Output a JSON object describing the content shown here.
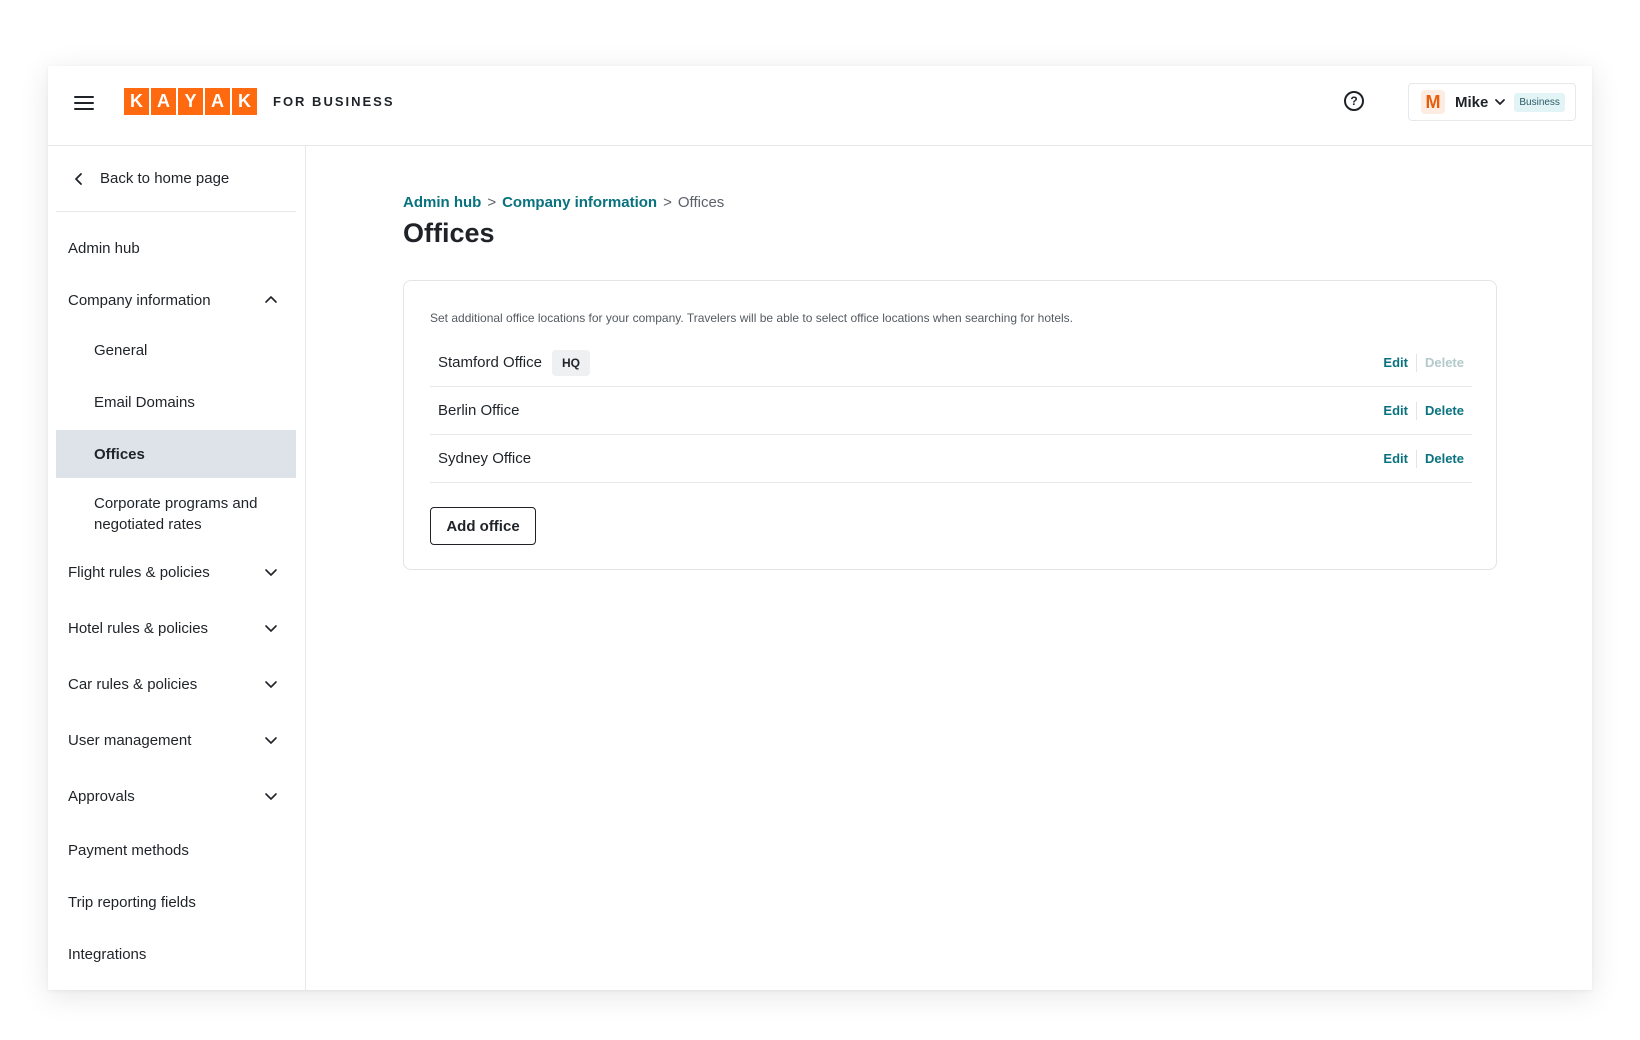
{
  "header": {
    "brand_letters": [
      "K",
      "A",
      "Y",
      "A",
      "K"
    ],
    "brand_suffix": "FOR BUSINESS",
    "user": {
      "avatar_initial": "M",
      "name": "Mike",
      "badge": "Business"
    },
    "brand_color": "#ff690f",
    "icons": [
      "hamburger-menu-icon",
      "help-icon",
      "chevron-down-icon"
    ]
  },
  "sidebar": {
    "back_label": "Back to home page",
    "items": [
      {
        "label": "Admin hub"
      },
      {
        "label": "Company information",
        "expanded": true
      },
      {
        "label": "General"
      },
      {
        "label": "Email Domains"
      },
      {
        "label": "Offices",
        "active": true
      },
      {
        "label": "Corporate programs and negotiated rates"
      },
      {
        "label": "Flight rules & policies"
      },
      {
        "label": "Hotel rules & policies"
      },
      {
        "label": "Car rules & policies"
      },
      {
        "label": "User management"
      },
      {
        "label": "Approvals"
      },
      {
        "label": "Payment methods"
      },
      {
        "label": "Trip reporting fields"
      },
      {
        "label": "Integrations"
      }
    ]
  },
  "breadcrumb": {
    "items": [
      "Admin hub",
      "Company information",
      "Offices"
    ],
    "separator": ">"
  },
  "page": {
    "title": "Offices"
  },
  "offices": {
    "description": "Set additional office locations for your company. Travelers will be able to select office locations when searching for hotels.",
    "rows": [
      {
        "name": "Stamford Office",
        "badge": "HQ",
        "edit": "Edit",
        "delete": "Delete",
        "delete_disabled": true
      },
      {
        "name": "Berlin Office",
        "edit": "Edit",
        "delete": "Delete"
      },
      {
        "name": "Sydney Office",
        "edit": "Edit",
        "delete": "Delete"
      }
    ],
    "add_label": "Add office"
  },
  "colors": {
    "link": "#08727f",
    "active_nav_bg": "#dde3e8"
  }
}
